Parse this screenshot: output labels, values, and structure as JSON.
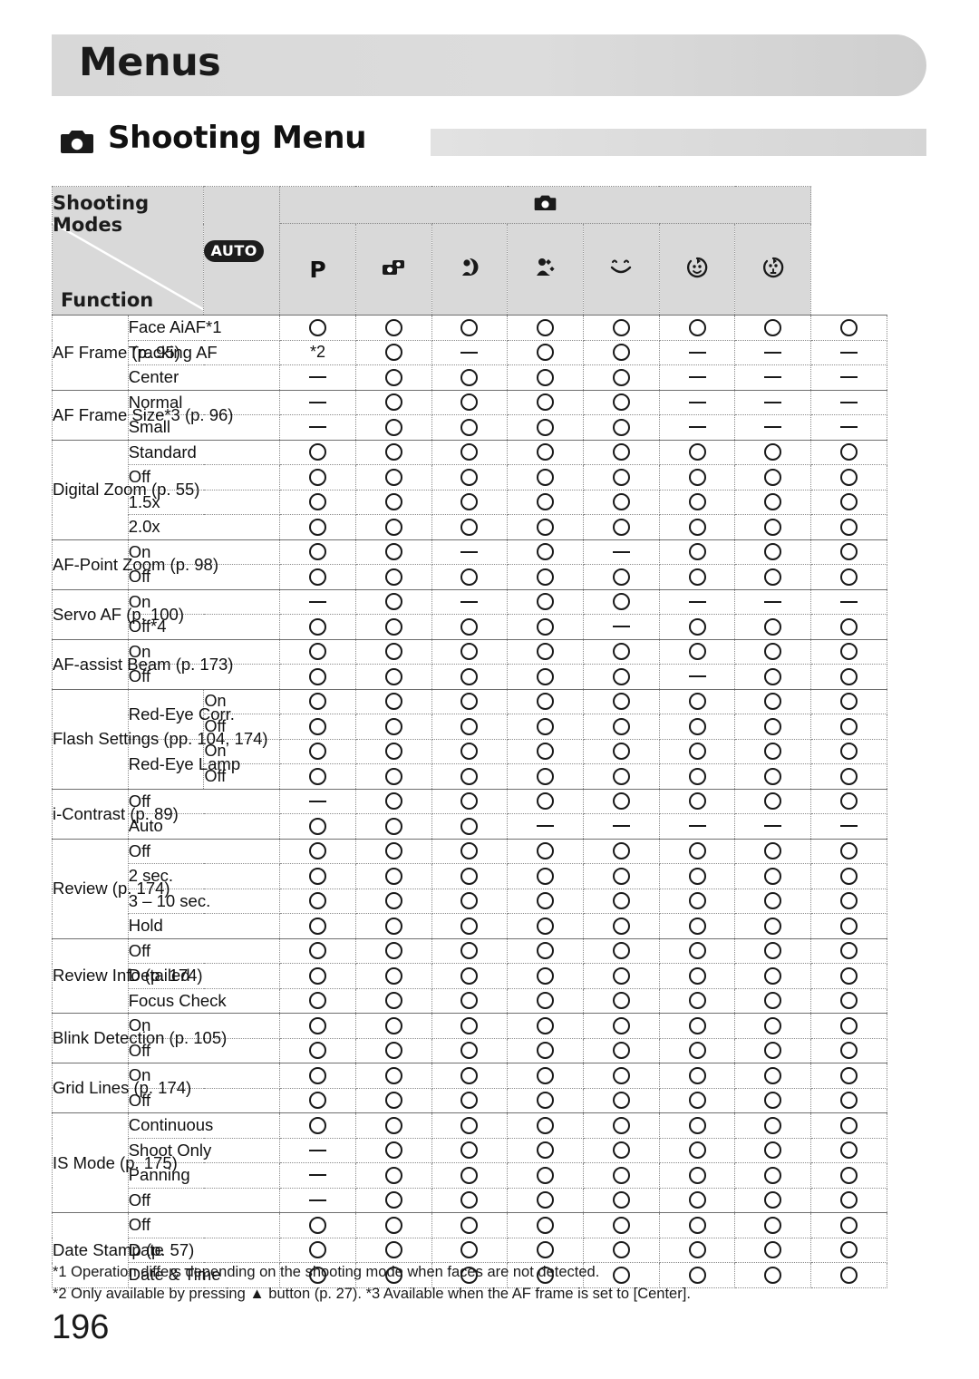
{
  "banner": {
    "title": "Menus"
  },
  "section": {
    "title": "Shooting Menu",
    "icon": "camera-icon"
  },
  "table": {
    "header": {
      "shooting_modes_label": "Shooting Modes",
      "function_label": "Function",
      "group_icon": "camera-icon",
      "mode_columns": [
        {
          "id": "auto",
          "label": "AUTO",
          "icon": "auto-mode-icon"
        },
        {
          "id": "p",
          "label": "P",
          "icon": "program-mode-icon"
        },
        {
          "id": "scn1",
          "label": "",
          "icon": "portrait-scene-icon"
        },
        {
          "id": "scn2",
          "label": "",
          "icon": "low-light-scene-icon"
        },
        {
          "id": "scn3",
          "label": "",
          "icon": "snow-scene-icon"
        },
        {
          "id": "scn4",
          "label": "",
          "icon": "smile-scene-icon"
        },
        {
          "id": "scn5",
          "label": "",
          "icon": "wink-self-timer-icon"
        },
        {
          "id": "scn6",
          "label": "",
          "icon": "face-self-timer-icon"
        }
      ]
    },
    "groups": [
      {
        "function": "AF Frame (p. 95)",
        "rows": [
          {
            "option": "Face AiAF*1",
            "values": [
              "O",
              "O",
              "O",
              "O",
              "O",
              "O",
              "O",
              "O"
            ]
          },
          {
            "option": "Tracking AF",
            "values": [
              "*2",
              "O",
              "-",
              "O",
              "O",
              "-",
              "-",
              "-"
            ]
          },
          {
            "option": "Center",
            "values": [
              "-",
              "O",
              "O",
              "O",
              "O",
              "-",
              "-",
              "-"
            ]
          }
        ]
      },
      {
        "function": "AF Frame Size*3 (p. 96)",
        "rows": [
          {
            "option": "Normal",
            "values": [
              "-",
              "O",
              "O",
              "O",
              "O",
              "-",
              "-",
              "-"
            ]
          },
          {
            "option": "Small",
            "values": [
              "-",
              "O",
              "O",
              "O",
              "O",
              "-",
              "-",
              "-"
            ]
          }
        ]
      },
      {
        "function": "Digital Zoom (p. 55)",
        "rows": [
          {
            "option": "Standard",
            "values": [
              "O",
              "O",
              "O",
              "O",
              "O",
              "O",
              "O",
              "O"
            ]
          },
          {
            "option": "Off",
            "values": [
              "O",
              "O",
              "O",
              "O",
              "O",
              "O",
              "O",
              "O"
            ]
          },
          {
            "option": "1.5x",
            "values": [
              "O",
              "O",
              "O",
              "O",
              "O",
              "O",
              "O",
              "O"
            ]
          },
          {
            "option": "2.0x",
            "values": [
              "O",
              "O",
              "O",
              "O",
              "O",
              "O",
              "O",
              "O"
            ]
          }
        ]
      },
      {
        "function": "AF-Point Zoom (p. 98)",
        "rows": [
          {
            "option": "On",
            "values": [
              "O",
              "O",
              "-",
              "O",
              "-",
              "O",
              "O",
              "O"
            ]
          },
          {
            "option": "Off",
            "values": [
              "O",
              "O",
              "O",
              "O",
              "O",
              "O",
              "O",
              "O"
            ]
          }
        ]
      },
      {
        "function": "Servo AF (p. 100)",
        "rows": [
          {
            "option": "On",
            "values": [
              "-",
              "O",
              "-",
              "O",
              "O",
              "-",
              "-",
              "-"
            ]
          },
          {
            "option": "Off*4",
            "values": [
              "O",
              "O",
              "O",
              "O",
              "-",
              "O",
              "O",
              "O"
            ]
          }
        ]
      },
      {
        "function": "AF-assist Beam (p. 173)",
        "rows": [
          {
            "option": "On",
            "values": [
              "O",
              "O",
              "O",
              "O",
              "O",
              "O",
              "O",
              "O"
            ]
          },
          {
            "option": "Off",
            "values": [
              "O",
              "O",
              "O",
              "O",
              "O",
              "-",
              "O",
              "O"
            ]
          }
        ]
      },
      {
        "function": "Flash Settings (pp. 104, 174)",
        "rows": [
          {
            "option": "Red-Eye Corr.",
            "sub": "On",
            "rowspan": 2,
            "values": [
              "O",
              "O",
              "O",
              "O",
              "O",
              "O",
              "O",
              "O"
            ]
          },
          {
            "option": "",
            "sub": "Off",
            "values": [
              "O",
              "O",
              "O",
              "O",
              "O",
              "O",
              "O",
              "O"
            ]
          },
          {
            "option": "Red-Eye Lamp",
            "sub": "On",
            "rowspan": 2,
            "values": [
              "O",
              "O",
              "O",
              "O",
              "O",
              "O",
              "O",
              "O"
            ]
          },
          {
            "option": "",
            "sub": "Off",
            "values": [
              "O",
              "O",
              "O",
              "O",
              "O",
              "O",
              "O",
              "O"
            ]
          }
        ]
      },
      {
        "function": "i-Contrast (p. 89)",
        "rows": [
          {
            "option": "Off",
            "values": [
              "-",
              "O",
              "O",
              "O",
              "O",
              "O",
              "O",
              "O"
            ]
          },
          {
            "option": "Auto",
            "values": [
              "O",
              "O",
              "O",
              "-",
              "-",
              "-",
              "-",
              "-"
            ]
          }
        ]
      },
      {
        "function": "Review (p. 174)",
        "rows": [
          {
            "option": "Off",
            "values": [
              "O",
              "O",
              "O",
              "O",
              "O",
              "O",
              "O",
              "O"
            ]
          },
          {
            "option": "2 sec.",
            "values": [
              "O",
              "O",
              "O",
              "O",
              "O",
              "O",
              "O",
              "O"
            ]
          },
          {
            "option": "3 – 10 sec.",
            "values": [
              "O",
              "O",
              "O",
              "O",
              "O",
              "O",
              "O",
              "O"
            ]
          },
          {
            "option": "Hold",
            "values": [
              "O",
              "O",
              "O",
              "O",
              "O",
              "O",
              "O",
              "O"
            ]
          }
        ]
      },
      {
        "function": "Review Info (p. 174)",
        "rows": [
          {
            "option": "Off",
            "values": [
              "O",
              "O",
              "O",
              "O",
              "O",
              "O",
              "O",
              "O"
            ]
          },
          {
            "option": "Detailed",
            "values": [
              "O",
              "O",
              "O",
              "O",
              "O",
              "O",
              "O",
              "O"
            ]
          },
          {
            "option": "Focus Check",
            "values": [
              "O",
              "O",
              "O",
              "O",
              "O",
              "O",
              "O",
              "O"
            ]
          }
        ]
      },
      {
        "function": "Blink Detection (p. 105)",
        "rows": [
          {
            "option": "On",
            "values": [
              "O",
              "O",
              "O",
              "O",
              "O",
              "O",
              "O",
              "O"
            ]
          },
          {
            "option": "Off",
            "values": [
              "O",
              "O",
              "O",
              "O",
              "O",
              "O",
              "O",
              "O"
            ]
          }
        ]
      },
      {
        "function": "Grid Lines (p. 174)",
        "rows": [
          {
            "option": "On",
            "values": [
              "O",
              "O",
              "O",
              "O",
              "O",
              "O",
              "O",
              "O"
            ]
          },
          {
            "option": "Off",
            "values": [
              "O",
              "O",
              "O",
              "O",
              "O",
              "O",
              "O",
              "O"
            ]
          }
        ]
      },
      {
        "function": "IS Mode (p. 175)",
        "rows": [
          {
            "option": "Continuous",
            "values": [
              "O",
              "O",
              "O",
              "O",
              "O",
              "O",
              "O",
              "O"
            ]
          },
          {
            "option": "Shoot Only",
            "values": [
              "-",
              "O",
              "O",
              "O",
              "O",
              "O",
              "O",
              "O"
            ]
          },
          {
            "option": "Panning",
            "values": [
              "-",
              "O",
              "O",
              "O",
              "O",
              "O",
              "O",
              "O"
            ]
          },
          {
            "option": "Off",
            "values": [
              "-",
              "O",
              "O",
              "O",
              "O",
              "O",
              "O",
              "O"
            ]
          }
        ]
      },
      {
        "function": "Date Stamp (p. 57)",
        "rows": [
          {
            "option": "Off",
            "values": [
              "O",
              "O",
              "O",
              "O",
              "O",
              "O",
              "O",
              "O"
            ]
          },
          {
            "option": "Date",
            "values": [
              "O",
              "O",
              "O",
              "O",
              "O",
              "O",
              "O",
              "O"
            ]
          },
          {
            "option": "Date & Time",
            "values": [
              "O",
              "O",
              "O",
              "O",
              "O",
              "O",
              "O",
              "O"
            ]
          }
        ]
      }
    ]
  },
  "footnotes": [
    "*1 Operation differs depending on the shooting mode when faces are not detected.",
    "*2 Only available by pressing ▲ button (p. 27). *3 Available when the AF frame is set to [Center]."
  ],
  "page_number": "196"
}
